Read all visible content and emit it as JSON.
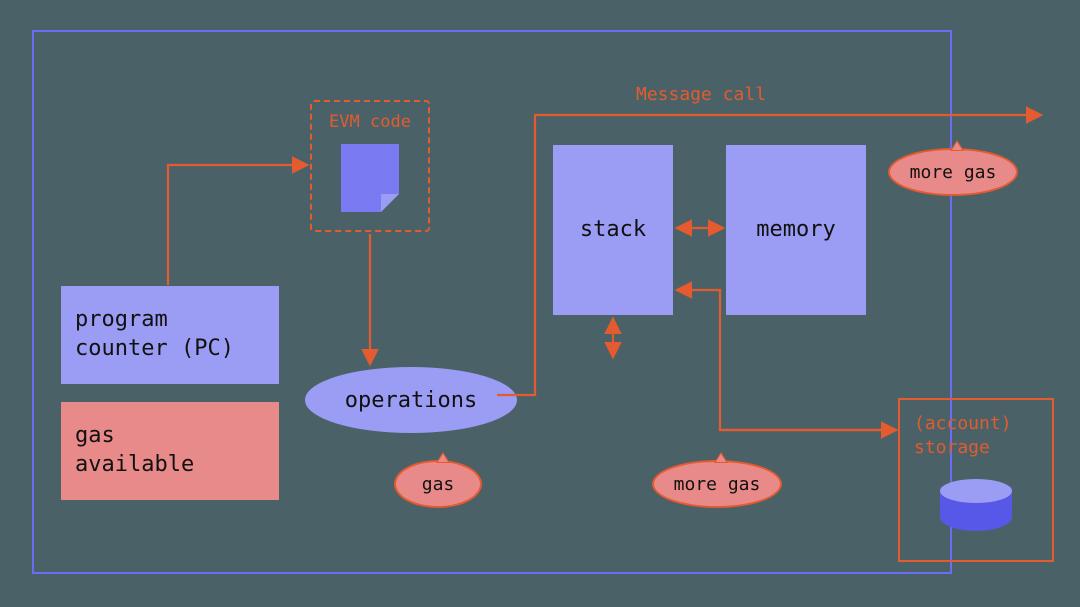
{
  "labels": {
    "program_counter": "program\ncounter (PC)",
    "gas_available": "gas\navailable",
    "stack": "stack",
    "memory": "memory",
    "operations": "operations",
    "evm_code": "EVM code",
    "message_call": "Message call",
    "account_storage_1": "(account)",
    "account_storage_2": "storage"
  },
  "bubbles": {
    "gas": "gas",
    "more_gas_1": "more gas",
    "more_gas_2": "more gas"
  },
  "colors": {
    "background": "#4a6267",
    "frame": "#6c6df5",
    "box_fill": "#9b9cf3",
    "red_fill": "#e98a8a",
    "accent": "#e35b2e",
    "doc_fill": "#7a7bf2",
    "cyl_body": "#5858e8"
  },
  "diagram": {
    "nodes": [
      {
        "id": "program-counter",
        "type": "rect",
        "label": "program counter (PC)"
      },
      {
        "id": "gas-available",
        "type": "rect",
        "label": "gas available"
      },
      {
        "id": "evm-code",
        "type": "dashed-rect",
        "label": "EVM code"
      },
      {
        "id": "operations",
        "type": "ellipse",
        "label": "operations"
      },
      {
        "id": "stack",
        "type": "rect",
        "label": "stack"
      },
      {
        "id": "memory",
        "type": "rect",
        "label": "memory"
      },
      {
        "id": "account-storage",
        "type": "rect",
        "label": "(account) storage"
      },
      {
        "id": "gas-bubble",
        "type": "speech",
        "label": "gas"
      },
      {
        "id": "more-gas-1",
        "type": "speech",
        "label": "more gas"
      },
      {
        "id": "more-gas-2",
        "type": "speech",
        "label": "more gas"
      }
    ],
    "edges": [
      {
        "from": "program-counter",
        "to": "evm-code",
        "type": "arrow"
      },
      {
        "from": "evm-code",
        "to": "operations",
        "type": "arrow"
      },
      {
        "from": "operations",
        "to": "stack",
        "type": "double-arrow"
      },
      {
        "from": "stack",
        "to": "memory",
        "type": "double-arrow"
      },
      {
        "from": "operations",
        "to": "message-call",
        "type": "arrow",
        "label": "Message call"
      },
      {
        "from": "stack",
        "to": "account-storage",
        "type": "arrow"
      },
      {
        "from": "account-storage",
        "to": "stack",
        "type": "arrow"
      }
    ]
  }
}
